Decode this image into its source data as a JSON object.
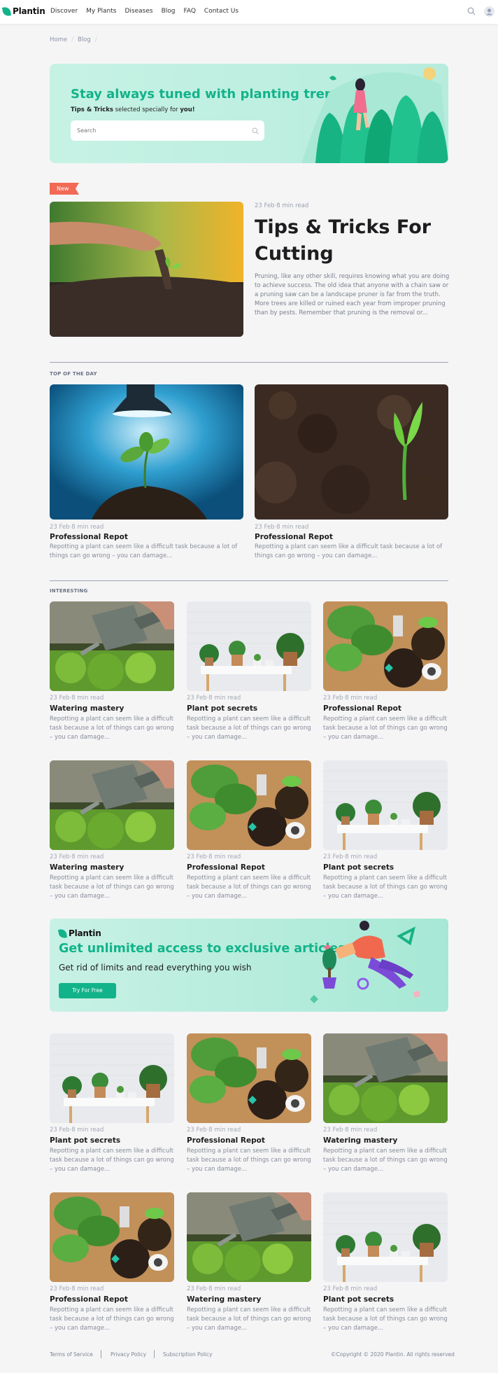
{
  "nav": {
    "logo": "Plantin",
    "links": [
      "Discover",
      "My Plants",
      "Diseases",
      "Blog",
      "FAQ",
      "Contact Us"
    ]
  },
  "breadcrumb": [
    "Home",
    "/",
    "Blog",
    "/"
  ],
  "hero": {
    "title": "Stay always tuned with planting trends",
    "subtitle_bold": "Tips & Tricks",
    "subtitle_mid": " selected specially for ",
    "subtitle_end": "you!",
    "search_placeholder": "Search"
  },
  "featured": {
    "badge": "New",
    "meta": "23 Feb·8 min read",
    "title": "Tips & Tricks For Cutting",
    "text": "Pruning, like any other skill, requires knowing what you are doing to achieve success. The old idea that anyone with a chain saw or a pruning saw can be a landscape pruner is far from the truth. More trees are killed or ruined each year from improper pruning than by pests. Remember that pruning is the removal or..."
  },
  "top_of_day": {
    "label": "TOP OF THE DAY",
    "cards": [
      {
        "meta": "23 Feb·8 min read",
        "title": "Professional Repot",
        "text": "Repotting a plant can seem like a difficult task because a lot of things can go wrong – you can damage...",
        "image": "lamp"
      },
      {
        "meta": "23 Feb·8 min read",
        "title": "Professional Repot",
        "text": "Repotting a plant can seem like a difficult task because a lot of things can go wrong – you can damage...",
        "image": "sprout"
      }
    ]
  },
  "interesting": {
    "label": "INTERESTING",
    "cards": [
      {
        "meta": "23 Feb·8 min read",
        "title": "Watering mastery",
        "text": "Repotting a plant can seem like a difficult task because a lot of things can go wrong – you can damage...",
        "image": "watering"
      },
      {
        "meta": "23 Feb·8 min read",
        "title": "Plant pot secrets",
        "text": "Repotting a plant can seem like a difficult task because a lot of things can go wrong – you can damage...",
        "image": "shelf"
      },
      {
        "meta": "23 Feb·8 min read",
        "title": "Professional Repot",
        "text": "Repotting a plant can seem like a difficult task because a lot of things can go wrong – you can damage...",
        "image": "repot"
      },
      {
        "meta": "23 Feb·8 min read",
        "title": "Watering mastery",
        "text": "Repotting a plant can seem like a difficult task because a lot of things can go wrong – you can damage...",
        "image": "watering"
      },
      {
        "meta": "23 Feb·8 min read",
        "title": "Professional Repot",
        "text": "Repotting a plant can seem like a difficult task because a lot of things can go wrong – you can damage...",
        "image": "repot"
      },
      {
        "meta": "23 Feb·8 min read",
        "title": "Plant pot secrets",
        "text": "Repotting a plant can seem like a difficult task because a lot of things can go wrong – you can damage...",
        "image": "shelf"
      }
    ]
  },
  "promo": {
    "logo": "Plantin",
    "title": "Get unlimited access to exclusive articles",
    "subtitle": "Get rid of limits and read everything you wish",
    "button": "Try For Free"
  },
  "more": {
    "cards": [
      {
        "meta": "23 Feb·8 min read",
        "title": "Plant pot secrets",
        "text": "Repotting a plant can seem like a difficult task because a lot of things can go wrong – you can damage...",
        "image": "shelf"
      },
      {
        "meta": "23 Feb·8 min read",
        "title": "Professional Repot",
        "text": "Repotting a plant can seem like a difficult task because a lot of things can go wrong – you can damage...",
        "image": "repot"
      },
      {
        "meta": "23 Feb·8 min read",
        "title": "Watering mastery",
        "text": "Repotting a plant can seem like a difficult task because a lot of things can go wrong – you can damage...",
        "image": "watering"
      },
      {
        "meta": "23 Feb·8 min read",
        "title": "Professional Repot",
        "text": "Repotting a plant can seem like a difficult task because a lot of things can go wrong – you can damage...",
        "image": "repot"
      },
      {
        "meta": "23 Feb·8 min read",
        "title": "Watering mastery",
        "text": "Repotting a plant can seem like a difficult task because a lot of things can go wrong – you can damage...",
        "image": "watering"
      },
      {
        "meta": "23 Feb·8 min read",
        "title": "Plant pot secrets",
        "text": "Repotting a plant can seem like a difficult task because a lot of things can go wrong – you can damage...",
        "image": "shelf"
      }
    ]
  },
  "footer": {
    "links": [
      "Terms of Service",
      "Privacy Policy",
      "Subscription Policy"
    ],
    "copyright": "©Copyright © 2020 Plantin. All rights reserved"
  },
  "colors": {
    "accent": "#12b38a",
    "badge": "#f26a55",
    "hero_bg": "#c6f2e4"
  },
  "icons": [
    "leaf-logo-icon",
    "search-icon",
    "user-avatar-icon"
  ]
}
